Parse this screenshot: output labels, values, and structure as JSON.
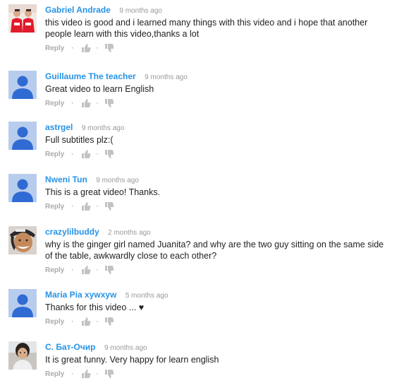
{
  "comments": [
    {
      "author": "Gabriel Andrade",
      "time": "9 months ago",
      "text": "this video is good and i learned many things with this video and i hope that another people learn with this video,thanks a lot",
      "avatar": "photo-two-people-red",
      "reply": "Reply",
      "separator": "·"
    },
    {
      "author": "Guillaume The teacher",
      "time": "9 months ago",
      "text": "Great video to learn English",
      "avatar": "default-user-icon",
      "reply": "Reply",
      "separator": "·"
    },
    {
      "author": "astrgel",
      "time": "9 months ago",
      "text": "Full subtitles plz:(",
      "avatar": "default-user-icon",
      "reply": "Reply",
      "separator": "·"
    },
    {
      "author": "Nweni Tun",
      "time": "9 months ago",
      "text": "This is a great video! Thanks.",
      "avatar": "default-user-icon",
      "reply": "Reply",
      "separator": "·"
    },
    {
      "author": "crazylilbuddy",
      "time": "2 months ago",
      "text": "why is the ginger girl named Juanita? and why are the two guy sitting on the same side of the table, awkwardly close to each other?",
      "avatar": "photo-man-cap",
      "reply": "Reply",
      "separator": "·"
    },
    {
      "author": "Maria Pia xywxyw",
      "time": "5 months ago",
      "text": "Thanks for this video ... ♥",
      "avatar": "default-user-icon",
      "reply": "Reply",
      "separator": "·"
    },
    {
      "author": "С. Бат-Очир",
      "time": "9 months ago",
      "text": "It is great funny. Very happy for learn english",
      "avatar": "photo-woman-outdoor",
      "reply": "Reply",
      "separator": "·"
    }
  ],
  "colors": {
    "author": "#2793e6",
    "time": "#999999",
    "text": "#222222",
    "actions": "#aaaaaa",
    "default_avatar_bg": "#b8ccee",
    "default_avatar_fg": "#2f6bd3"
  }
}
